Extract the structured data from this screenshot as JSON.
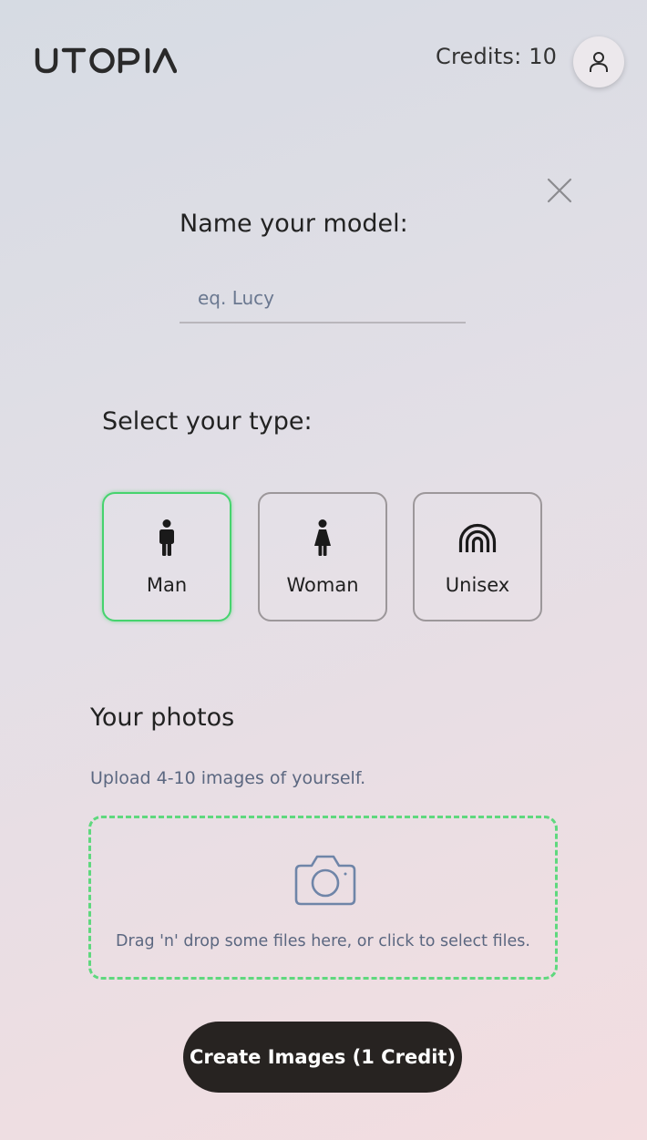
{
  "header": {
    "logo_text": "UTOPIA",
    "credits": "Credits: 10",
    "profile_icon": "user-icon"
  },
  "form": {
    "close_icon": "close-icon",
    "name_label": "Name your model:",
    "name_placeholder": "eq. Lucy",
    "name_value": "",
    "type_label": "Select your type:",
    "types": [
      {
        "label": "Man",
        "icon": "man-icon",
        "selected": true
      },
      {
        "label": "Woman",
        "icon": "woman-icon",
        "selected": false
      },
      {
        "label": "Unisex",
        "icon": "rainbow-icon",
        "selected": false
      }
    ],
    "photos_title": "Your photos",
    "photos_subtitle": "Upload 4-10 images of yourself.",
    "dropzone_icon": "camera-icon",
    "dropzone_text": "Drag 'n' drop some files here, or click to select files.",
    "submit_label": "Create Images (1 Credit)"
  },
  "colors": {
    "accent_green": "#46d36e",
    "button_dark": "#272321"
  }
}
